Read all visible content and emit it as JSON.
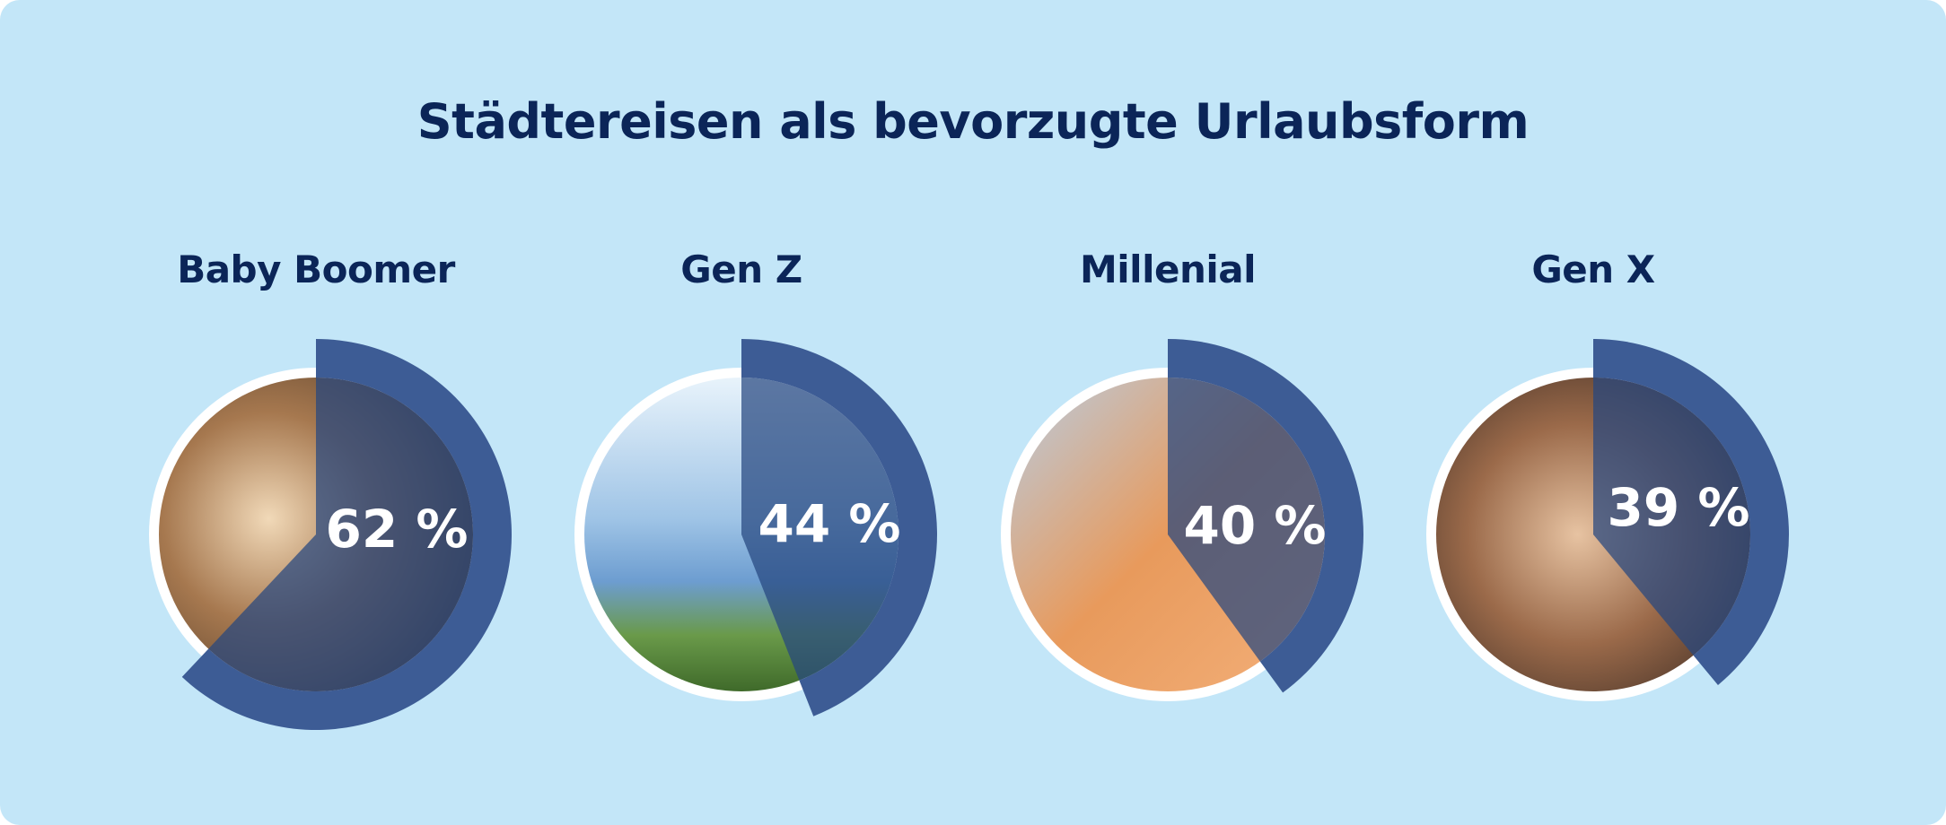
{
  "chart_data": {
    "type": "pie",
    "title": "Städtereisen als bevorzugte Urlaubsform",
    "categories": [
      "Baby Boomer",
      "Gen Z",
      "Millenial",
      "Gen X"
    ],
    "values": [
      62,
      44,
      40,
      39
    ],
    "value_labels": [
      "62 %",
      "44 %",
      "40 %",
      "39 %"
    ],
    "unit": "%",
    "colors": {
      "background": "#c3e6f8",
      "text": "#0b2558",
      "arc": "#3d5c95",
      "overlay": "#25467f",
      "photo_ring": "#ffffff"
    }
  }
}
